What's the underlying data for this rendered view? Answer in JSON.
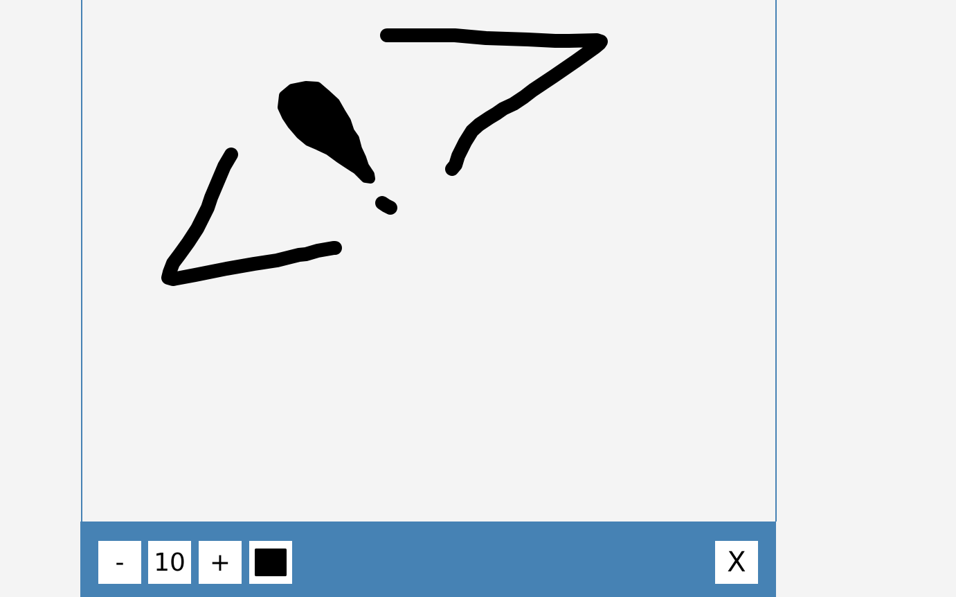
{
  "toolbar": {
    "decrease_label": "-",
    "brush_size": "10",
    "increase_label": "+",
    "close_label": "X"
  },
  "brush": {
    "color": "#000000"
  },
  "colors": {
    "toolbar_bg": "#4682b4",
    "canvas_bg": "#f4f4f4",
    "ink": "#000000"
  }
}
